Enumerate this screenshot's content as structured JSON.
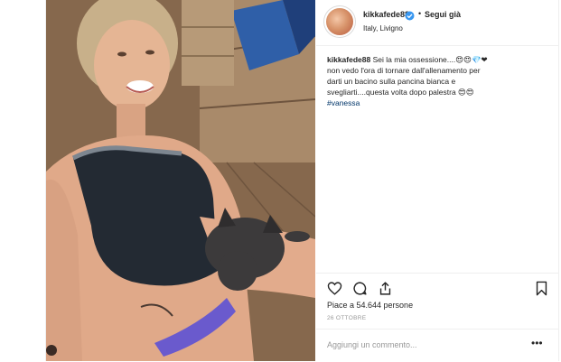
{
  "post": {
    "username": "kikkafede88",
    "follow_label": "Segui già",
    "separator": "•",
    "location": "Italy, Livigno",
    "caption": {
      "username": "kikkafede88",
      "line1": "Sei la mia ossessione....😍😍💎❤",
      "line2": "non vedo l'ora di tornare dall'allenamento per",
      "line3": "darti un bacino sulla pancina bianca e",
      "line4": "svegliarti....questa volta dopo palestra 😍😍",
      "hashtag": "#vanessa"
    },
    "likes": "Piace a 54.644 persone",
    "date": "26 OTTOBRE",
    "comment_placeholder": "Aggiungi un commento...",
    "more_label": "•••"
  },
  "icons": {
    "like": "heart-icon",
    "comment": "comment-icon",
    "share": "share-icon",
    "save": "bookmark-icon",
    "verified": "verified-badge-icon"
  },
  "colors": {
    "verified": "#3897f0",
    "hashtag": "#003569",
    "muted": "#999999",
    "border": "#efefef"
  }
}
